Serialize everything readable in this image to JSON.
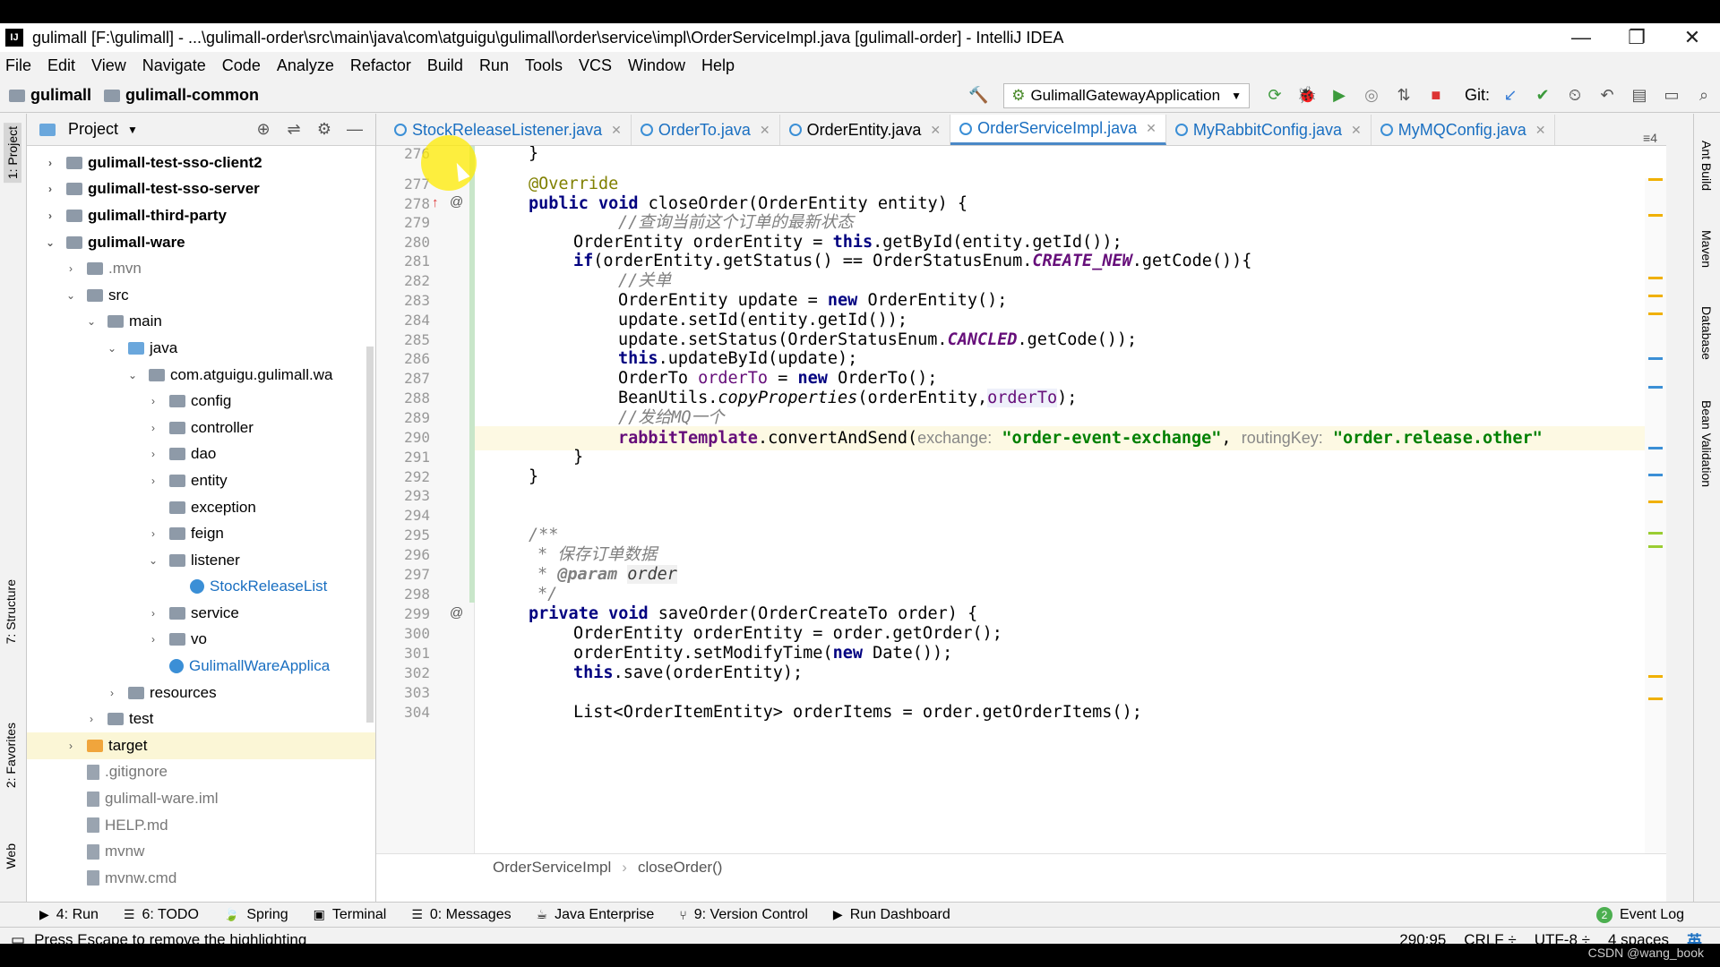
{
  "window": {
    "title": "gulimall [F:\\gulimall] - ...\\gulimall-order\\src\\main\\java\\com\\atguigu\\gulimall\\order\\service\\impl\\OrderServiceImpl.java [gulimall-order] - IntelliJ IDEA",
    "app_icon": "IJ",
    "minimize": "—",
    "restore": "❐",
    "close": "✕"
  },
  "menu": [
    "File",
    "Edit",
    "View",
    "Navigate",
    "Code",
    "Analyze",
    "Refactor",
    "Build",
    "Run",
    "Tools",
    "VCS",
    "Window",
    "Help"
  ],
  "nav": {
    "crumb1": "gulimall",
    "crumb2": "gulimall-common",
    "run_config": "GulimallGatewayApplication",
    "git_label": "Git:"
  },
  "left_tool_tabs": {
    "project": "1: Project",
    "structure": "7: Structure",
    "favorites": "2: Favorites",
    "web": "Web"
  },
  "right_tool_tabs": {
    "ant": "Ant Build",
    "maven": "Maven",
    "database": "Database",
    "bean": "Bean Validation"
  },
  "project_panel": {
    "title": "Project"
  },
  "tree": [
    {
      "label": "gulimall-test-sso-client2",
      "level": 0,
      "arrow": "›",
      "bold": true,
      "icon": "folder"
    },
    {
      "label": "gulimall-test-sso-server",
      "level": 0,
      "arrow": "›",
      "bold": true,
      "icon": "folder"
    },
    {
      "label": "gulimall-third-party",
      "level": 0,
      "arrow": "›",
      "bold": true,
      "icon": "folder"
    },
    {
      "label": "gulimall-ware",
      "level": 0,
      "arrow": "⌄",
      "bold": true,
      "icon": "folder"
    },
    {
      "label": ".mvn",
      "level": 1,
      "arrow": "›",
      "icon": "folder",
      "gray": true
    },
    {
      "label": "src",
      "level": 1,
      "arrow": "⌄",
      "icon": "folder"
    },
    {
      "label": "main",
      "level": 2,
      "arrow": "⌄",
      "icon": "folder"
    },
    {
      "label": "java",
      "level": 3,
      "arrow": "⌄",
      "icon": "folder-blue"
    },
    {
      "label": "com.atguigu.gulimall.wa",
      "level": 4,
      "arrow": "⌄",
      "icon": "folder"
    },
    {
      "label": "config",
      "level": 5,
      "arrow": "›",
      "icon": "folder"
    },
    {
      "label": "controller",
      "level": 5,
      "arrow": "›",
      "icon": "folder"
    },
    {
      "label": "dao",
      "level": 5,
      "arrow": "›",
      "icon": "folder"
    },
    {
      "label": "entity",
      "level": 5,
      "arrow": "›",
      "icon": "folder"
    },
    {
      "label": "exception",
      "level": 5,
      "arrow": "",
      "icon": "folder"
    },
    {
      "label": "feign",
      "level": 5,
      "arrow": "›",
      "icon": "folder"
    },
    {
      "label": "listener",
      "level": 5,
      "arrow": "⌄",
      "icon": "folder"
    },
    {
      "label": "StockReleaseList",
      "level": 6,
      "arrow": "",
      "icon": "java",
      "java": true
    },
    {
      "label": "service",
      "level": 5,
      "arrow": "›",
      "icon": "folder"
    },
    {
      "label": "vo",
      "level": 5,
      "arrow": "›",
      "icon": "folder"
    },
    {
      "label": "GulimallWareApplica",
      "level": 5,
      "arrow": "",
      "icon": "java",
      "java": true
    },
    {
      "label": "resources",
      "level": 3,
      "arrow": "›",
      "icon": "folder"
    },
    {
      "label": "test",
      "level": 2,
      "arrow": "›",
      "icon": "folder"
    },
    {
      "label": "target",
      "level": 1,
      "arrow": "›",
      "icon": "folder-orange",
      "selected": true
    },
    {
      "label": ".gitignore",
      "level": 1,
      "arrow": "",
      "icon": "file",
      "gray": true
    },
    {
      "label": "gulimall-ware.iml",
      "level": 1,
      "arrow": "",
      "icon": "file",
      "gray": true
    },
    {
      "label": "HELP.md",
      "level": 1,
      "arrow": "",
      "icon": "file",
      "gray": true
    },
    {
      "label": "mvnw",
      "level": 1,
      "arrow": "",
      "icon": "file",
      "gray": true
    },
    {
      "label": "mvnw.cmd",
      "level": 1,
      "arrow": "",
      "icon": "file",
      "gray": true
    }
  ],
  "tabs": [
    {
      "label": "StockReleaseListener.java",
      "active": false
    },
    {
      "label": "OrderTo.java",
      "active": false
    },
    {
      "label": "OrderEntity.java",
      "active": false
    },
    {
      "label": "OrderServiceImpl.java",
      "active": true
    },
    {
      "label": "MyRabbitConfig.java",
      "active": false
    },
    {
      "label": "MyMQConfig.java",
      "active": false
    }
  ],
  "tab_extra": "≡4",
  "line_numbers": [
    "276",
    "277",
    "278",
    "279",
    "280",
    "281",
    "282",
    "283",
    "284",
    "285",
    "286",
    "287",
    "288",
    "289",
    "290",
    "291",
    "292",
    "293",
    "294",
    "295",
    "296",
    "297",
    "298",
    "299",
    "300",
    "301",
    "302",
    "303",
    "304"
  ],
  "code": {
    "l277": "@Override",
    "l278a": "public void ",
    "l278b": "closeOrder(OrderEntity entity) {",
    "l279": "//查询当前这个订单的最新状态",
    "l280a": "OrderEntity orderEntity = ",
    "l280b": "this",
    ".l280c": "",
    "l280c": ".getById(entity.getId());",
    "l281a": "if",
    "l281b": "(orderEntity.getStatus() == OrderStatusEnum.",
    "l281c": "CREATE_NEW",
    "l281d": ".getCode()){",
    "l282": "//关单",
    "l283a": "OrderEntity update = ",
    "l283b": "new ",
    "l283c": "OrderEntity();",
    "l284": "update.setId(entity.getId());",
    "l285a": "update.setStatus(OrderStatusEnum.",
    "l285b": "CANCLED",
    "l285c": ".getCode());",
    "l286a": "this",
    "l286b": ".updateById(update);",
    "l287a": "OrderTo ",
    "l287b": "orderTo",
    " l287c": "",
    "l287c": " = ",
    "l287d": "new ",
    "l287e": "OrderTo();",
    "l288a": "BeanUtils.",
    "l288b": "copyProperties",
    "l288c": "(orderEntity,",
    "l288d": "orderTo",
    "l288e": ");",
    "l289": "//发给MQ一个",
    "l290a": "rabbitTemplate",
    ".l290b": "",
    "l290b": ".convertAndSend(",
    "l290c": "exchange:",
    "l290d": "\"order-event-exchange\"",
    "l290e": ", ",
    "l290f": "routingKey:",
    "l290g": "\"order.release.other\"",
    "l291": "}",
    "l292": "}",
    "l295": "/**",
    "l296": "* 保存订单数据",
    "l297a": "* ",
    "l297b": "@param ",
    "l297c": "order",
    "l298": "*/",
    "l299a": "private void ",
    "l299b": "saveOrder(OrderCreateTo order) {",
    "l300": "OrderEntity orderEntity = order.getOrder();",
    "l301a": "orderEntity.setModifyTime(",
    "l301b": "new ",
    "l301c": "Date());",
    "l302a": "this",
    "l302b": ".save(orderEntity);",
    "l304": "List<OrderItemEntity> orderItems = order.getOrderItems();",
    "l276": "}"
  },
  "breadcrumb": [
    "OrderServiceImpl",
    "closeOrder()"
  ],
  "tool_windows": [
    {
      "icon": "▶",
      "label": "4: Run"
    },
    {
      "icon": "☰",
      "label": "6: TODO"
    },
    {
      "icon": "🍃",
      "label": "Spring"
    },
    {
      "icon": "▣",
      "label": "Terminal"
    },
    {
      "icon": "☰",
      "label": "0: Messages"
    },
    {
      "icon": "☕",
      "label": "Java Enterprise"
    },
    {
      "icon": "⑂",
      "label": "9: Version Control"
    },
    {
      "icon": "▶",
      "label": "Run Dashboard"
    }
  ],
  "event_log": {
    "count": "2",
    "label": "Event Log"
  },
  "status": {
    "message": "Press Escape to remove the highlighting",
    "position": "290:95",
    "line_sep": "CRLF ÷",
    "encoding": "UTF-8 ÷",
    "indent": "4 spaces",
    "ime": "英"
  },
  "watermark": "CSDN @wang_book",
  "colors": {
    "keyword": "#000080",
    "comment": "#808080",
    "string": "#008000",
    "field": "#660e7a",
    "annotation": "#808000",
    "link": "#1a6fc1"
  }
}
